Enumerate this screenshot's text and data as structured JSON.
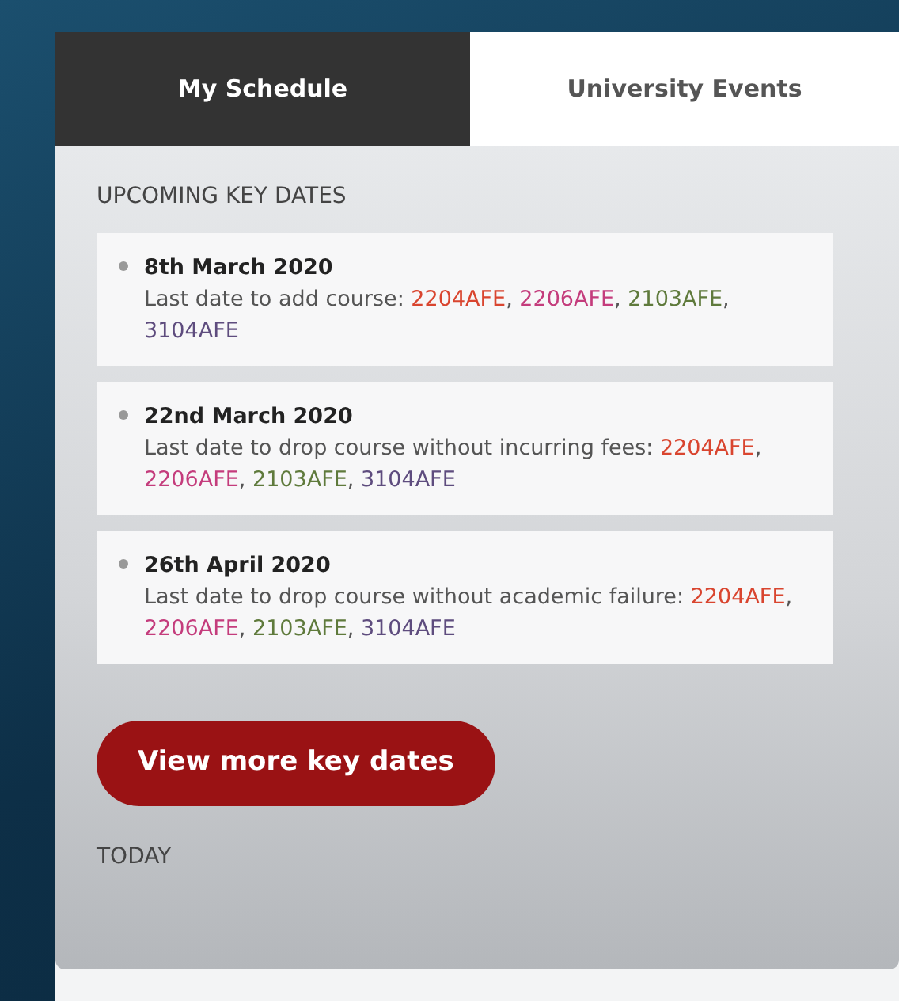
{
  "tabs": [
    {
      "label": "My Schedule",
      "selected": true
    },
    {
      "label": "University Events",
      "selected": false
    }
  ],
  "section_title": "UPCOMING KEY DATES",
  "key_dates": [
    {
      "date": "8th March 2020",
      "text": "Last date to add course:",
      "courses": [
        {
          "code": "2204AFE",
          "color": "#d9452f",
          "sep": ","
        },
        {
          "code": "2206AFE",
          "color": "#c43c7c",
          "sep": ","
        },
        {
          "code": "2103AFE",
          "color": "#5f7a3c",
          "sep": ","
        },
        {
          "code": "3104AFE",
          "color": "#5e4c7e"
        }
      ]
    },
    {
      "date": "22nd March 2020",
      "text": "Last date to drop course without incurring fees:",
      "courses": [
        {
          "code": "2204AFE",
          "color": "#d9452f",
          "sep": ","
        },
        {
          "code": "2206AFE",
          "color": "#c43c7c",
          "sep": ","
        },
        {
          "code": "2103AFE",
          "color": "#5f7a3c",
          "sep": ","
        },
        {
          "code": "3104AFE",
          "color": "#5e4c7e"
        }
      ]
    },
    {
      "date": "26th April 2020",
      "text": "Last date to drop course without academic failure:",
      "courses": [
        {
          "code": "2204AFE",
          "color": "#d9452f",
          "sep": ","
        },
        {
          "code": "2206AFE",
          "color": "#c43c7c",
          "sep": ","
        },
        {
          "code": "2103AFE",
          "color": "#5f7a3c",
          "sep": ","
        },
        {
          "code": "3104AFE",
          "color": "#5e4c7e"
        }
      ]
    }
  ],
  "button": "View more key dates",
  "footer_title": "TODAY"
}
